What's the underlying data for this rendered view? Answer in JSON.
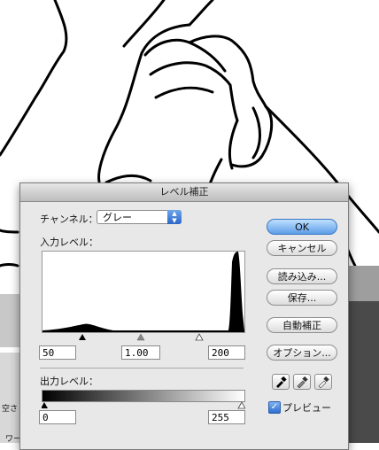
{
  "dialog": {
    "title": "レベル補正",
    "channel_label": "チャンネル：",
    "channel_value": "グレー",
    "input_levels_label": "入力レベル：",
    "input_shadow": "50",
    "input_gamma": "1.00",
    "input_highlight": "200",
    "output_levels_label": "出力レベル：",
    "output_shadow": "0",
    "output_highlight": "255",
    "buttons": {
      "ok": "OK",
      "cancel": "キャンセル",
      "load": "読み込み...",
      "save": "保存...",
      "auto": "自動補正",
      "options": "オプション..."
    },
    "preview_label": "プレビュー",
    "preview_checked": true
  },
  "workspace": {
    "left_text_1": "空さ",
    "left_text_2": "ワー"
  },
  "colors": {
    "default_button": "#5d9ee8",
    "dialog_bg": "#e8e8e8"
  },
  "icons": [
    "up-down-arrows-icon",
    "black-eyedropper-icon",
    "gray-eyedropper-icon",
    "white-eyedropper-icon",
    "checkmark-icon"
  ]
}
